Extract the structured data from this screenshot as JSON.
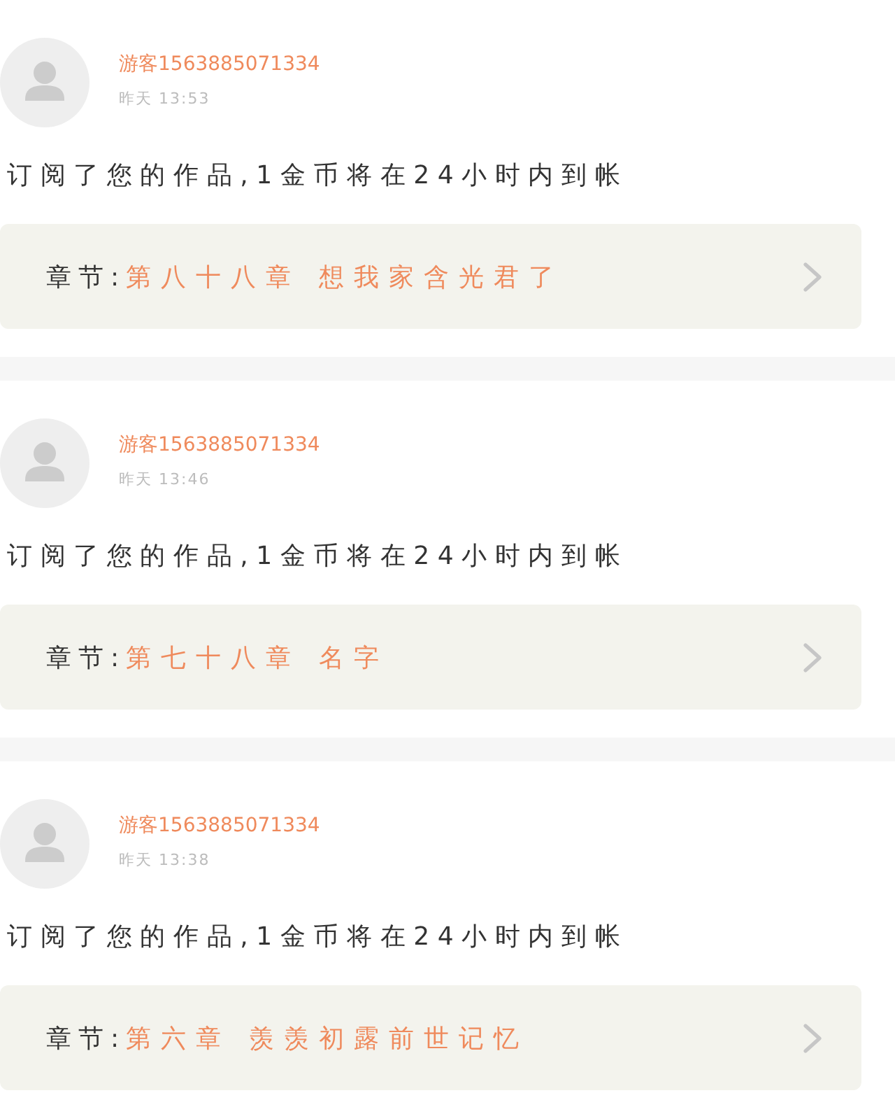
{
  "posts": [
    {
      "user": "游客1563885071334",
      "time": "昨天 13:53",
      "message": "订阅了您的作品,1金币将在24小时内到帐",
      "chapter_label": "章节:",
      "chapter_title": "第八十八章 想我家含光君了"
    },
    {
      "user": "游客1563885071334",
      "time": "昨天 13:46",
      "message": "订阅了您的作品,1金币将在24小时内到帐",
      "chapter_label": "章节:",
      "chapter_title": "第七十八章 名字"
    },
    {
      "user": "游客1563885071334",
      "time": "昨天 13:38",
      "message": "订阅了您的作品,1金币将在24小时内到帐",
      "chapter_label": "章节:",
      "chapter_title": "第六章 羡羡初露前世记忆"
    }
  ]
}
